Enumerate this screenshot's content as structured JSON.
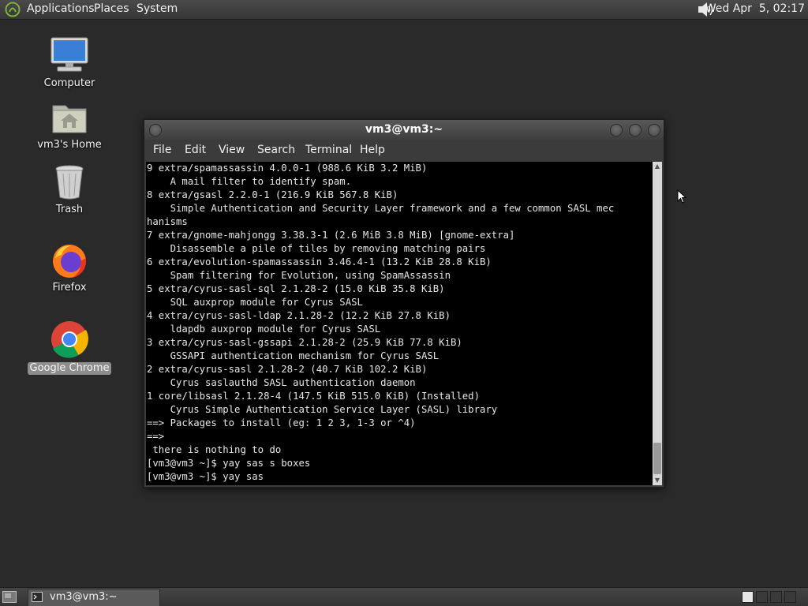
{
  "top_panel": {
    "menus": [
      "Applications",
      "Places",
      "System"
    ],
    "logo_icon": "mate-logo-icon",
    "volume_icon": "speaker-icon",
    "clock": "Wed Apr  5, 02:17"
  },
  "desktop": {
    "icons": [
      {
        "label": "Computer",
        "icon": "computer-icon"
      },
      {
        "label": "vm3's Home",
        "icon": "home-folder-icon"
      },
      {
        "label": "Trash",
        "icon": "trash-icon"
      },
      {
        "label": "Firefox",
        "icon": "firefox-icon"
      },
      {
        "label": "Google Chrome",
        "icon": "chrome-icon",
        "selected": true
      }
    ]
  },
  "terminal": {
    "title": "vm3@vm3:~",
    "menu": [
      "File",
      "Edit",
      "View",
      "Search",
      "Terminal",
      "Help"
    ],
    "lines": [
      "9 extra/spamassassin 4.0.0-1 (988.6 KiB 3.2 MiB)",
      "    A mail filter to identify spam.",
      "8 extra/gsasl 2.2.0-1 (216.9 KiB 567.8 KiB)",
      "    Simple Authentication and Security Layer framework and a few common SASL mec",
      "hanisms",
      "7 extra/gnome-mahjongg 3.38.3-1 (2.6 MiB 3.8 MiB) [gnome-extra]",
      "    Disassemble a pile of tiles by removing matching pairs",
      "6 extra/evolution-spamassassin 3.46.4-1 (13.2 KiB 28.8 KiB)",
      "    Spam filtering for Evolution, using SpamAssassin",
      "5 extra/cyrus-sasl-sql 2.1.28-2 (15.0 KiB 35.8 KiB)",
      "    SQL auxprop module for Cyrus SASL",
      "4 extra/cyrus-sasl-ldap 2.1.28-2 (12.2 KiB 27.8 KiB)",
      "    ldapdb auxprop module for Cyrus SASL",
      "3 extra/cyrus-sasl-gssapi 2.1.28-2 (25.9 KiB 77.8 KiB)",
      "    GSSAPI authentication mechanism for Cyrus SASL",
      "2 extra/cyrus-sasl 2.1.28-2 (40.7 KiB 102.2 KiB)",
      "    Cyrus saslauthd SASL authentication daemon",
      "1 core/libsasl 2.1.28-4 (147.5 KiB 515.0 KiB) (Installed)",
      "    Cyrus Simple Authentication Service Layer (SASL) library",
      "==> Packages to install (eg: 1 2 3, 1-3 or ^4)",
      "==>",
      " there is nothing to do",
      "[vm3@vm3 ~]$ yay sas s boxes",
      "[vm3@vm3 ~]$ yay sas"
    ]
  },
  "bottom_panel": {
    "show_desktop_icon": "show-desktop-icon",
    "task": {
      "label": "vm3@vm3:~",
      "icon": "terminal-icon"
    }
  }
}
